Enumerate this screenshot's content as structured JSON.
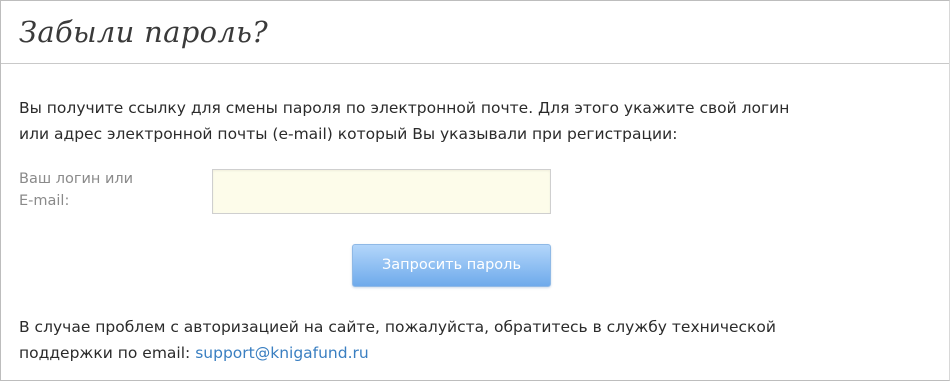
{
  "page": {
    "title": "Забыли пароль?"
  },
  "form": {
    "intro_line1": "Вы получите ссылку для смены пароля по электронной почте. Для этого укажите свой логин",
    "intro_line2": "или адрес электронной почты (e-mail) который Вы указывали при регистрации:",
    "login_label_line1": "Ваш логин или",
    "login_label_line2": "E-mail:",
    "login_value": "",
    "submit_label": "Запросить пароль"
  },
  "help": {
    "line1": "В случае проблем с авторизацией на сайте, пожалуйста, обратитесь в службу технической",
    "line2_prefix": "поддержки по email: ",
    "support_email": "support@knigafund.ru"
  },
  "colors": {
    "button_gradient_top": "#b3d6fa",
    "button_gradient_bottom": "#6eaaeb",
    "input_background": "#fdfcea",
    "link": "#3a7fc1"
  }
}
